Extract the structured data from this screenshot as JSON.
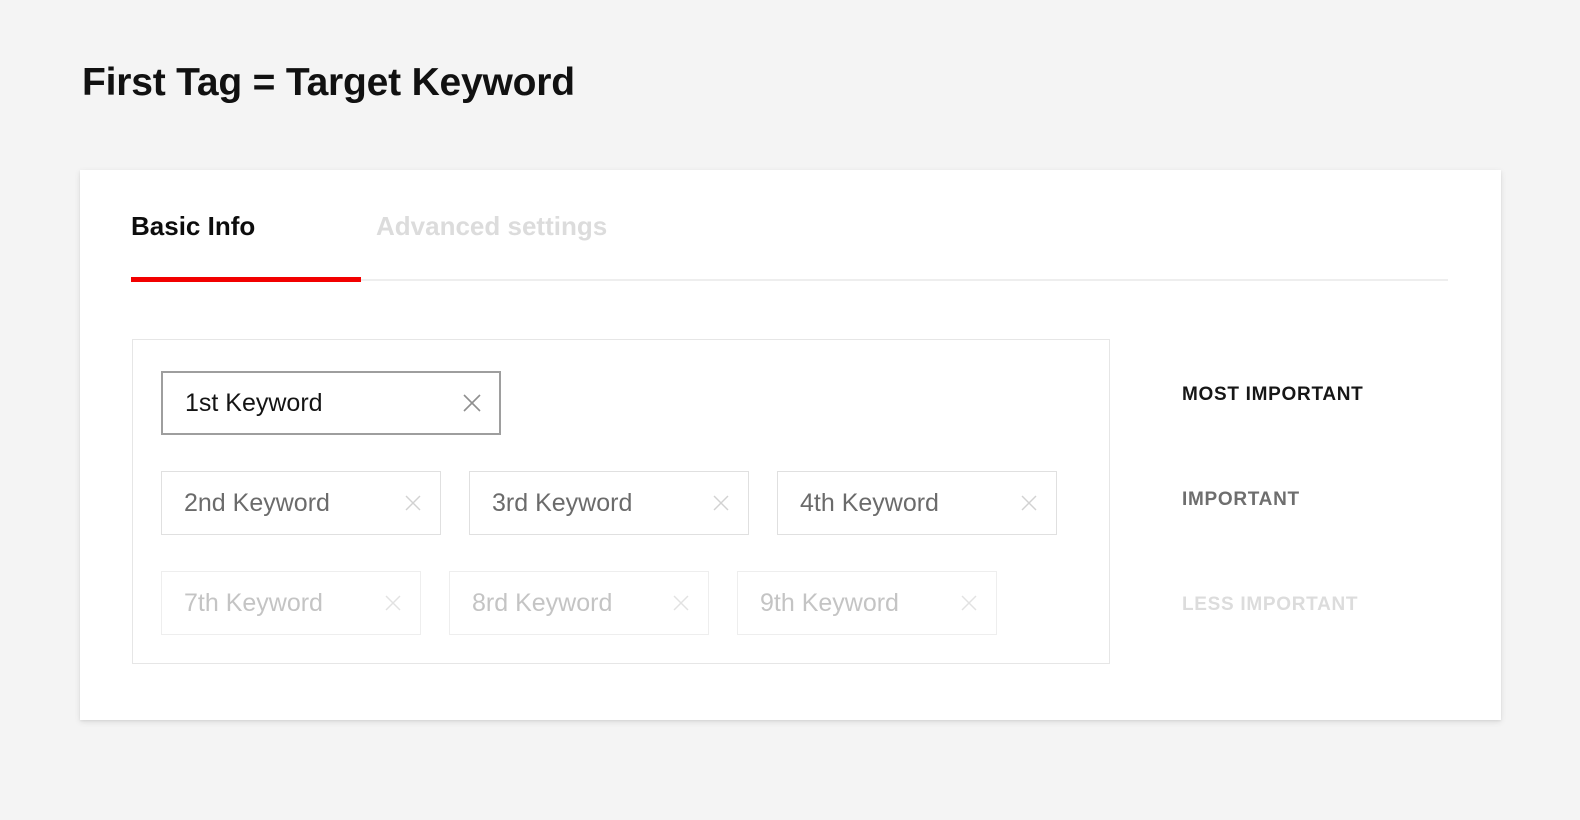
{
  "page": {
    "title": "First Tag = Target Keyword",
    "background_color": "#f4f4f4"
  },
  "card": {
    "background_color": "#ffffff"
  },
  "tabs": {
    "accent_color": "#f20000",
    "items": [
      {
        "label": "Basic Info",
        "active": true
      },
      {
        "label": "Advanced settings",
        "active": false
      }
    ]
  },
  "keywords": {
    "remove_icon": "close-icon",
    "tiers": [
      {
        "priority": "MOST IMPORTANT",
        "chips": [
          {
            "label": "1st Keyword"
          }
        ]
      },
      {
        "priority": "IMPORTANT",
        "chips": [
          {
            "label": "2nd Keyword"
          },
          {
            "label": "3rd Keyword"
          },
          {
            "label": "4th Keyword"
          }
        ]
      },
      {
        "priority": "LESS IMPORTANT",
        "chips": [
          {
            "label": "7th Keyword"
          },
          {
            "label": "8rd Keyword"
          },
          {
            "label": "9th Keyword"
          }
        ]
      }
    ]
  },
  "legend": {
    "most_important": "MOST IMPORTANT",
    "important": "IMPORTANT",
    "less_important": "LESS IMPORTANT"
  }
}
